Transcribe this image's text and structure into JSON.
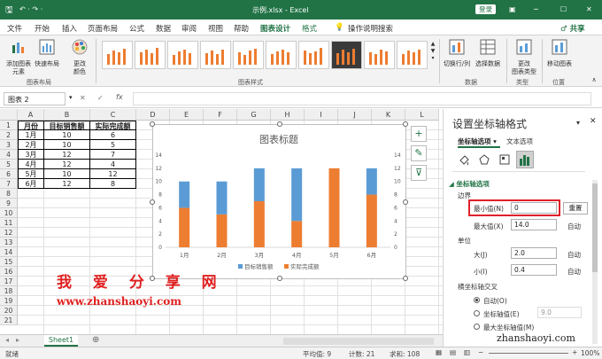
{
  "titlebar": {
    "qat_autosave": "↶ · ↷ ·",
    "filename": "示例.xlsx - Excel",
    "login": "登录",
    "window_controls": [
      "─",
      "☐",
      "✕"
    ]
  },
  "tabs": [
    "文件",
    "开始",
    "插入",
    "页面布局",
    "公式",
    "数据",
    "审阅",
    "视图",
    "帮助",
    "图表设计",
    "格式"
  ],
  "active_tab": "图表设计",
  "tell_me": "操作说明搜索",
  "share": "共享",
  "ribbon": {
    "add_element": "添加图表\n元素",
    "quick_layout": "快速布局",
    "change_colors": "更改\n颜色",
    "group_layout": "图表布局",
    "group_styles": "图表样式",
    "switch_rowcol": "切换行/列",
    "select_data": "选择数据",
    "group_data": "数据",
    "change_type": "更改\n图表类型",
    "group_type": "类型",
    "move_chart": "移动图表",
    "group_location": "位置"
  },
  "formula_bar": {
    "name_box": "图表 2",
    "cancel": "✕",
    "enter": "✓",
    "fx": "fx"
  },
  "columns": [
    "A",
    "B",
    "C",
    "D",
    "E",
    "F",
    "G",
    "H",
    "I",
    "J",
    "K",
    "L"
  ],
  "rows": [
    "1",
    "2",
    "3",
    "4",
    "5",
    "6",
    "7",
    "8",
    "9",
    "10",
    "11",
    "12",
    "13",
    "14",
    "15",
    "16",
    "17",
    "18",
    "19",
    "20",
    "21"
  ],
  "table": {
    "headers": [
      "月份",
      "目标销售额",
      "实际完成额"
    ],
    "rows": [
      [
        "1月",
        "10",
        "6"
      ],
      [
        "2月",
        "10",
        "5"
      ],
      [
        "3月",
        "12",
        "7"
      ],
      [
        "4月",
        "12",
        "4"
      ],
      [
        "5月",
        "10",
        "12"
      ],
      [
        "6月",
        "12",
        "8"
      ]
    ]
  },
  "chart_data": {
    "type": "bar",
    "stacked": true,
    "title": "图表标题",
    "categories": [
      "1月",
      "2月",
      "3月",
      "4月",
      "5月",
      "6月"
    ],
    "series": [
      {
        "name": "实际完成额",
        "values": [
          6,
          5,
          7,
          4,
          12,
          8
        ],
        "color": "#ed7d31"
      },
      {
        "name": "目标销售额",
        "values": [
          4,
          5,
          5,
          8,
          0,
          4
        ],
        "color": "#5b9bd5"
      }
    ],
    "ylim": [
      0,
      14
    ],
    "yticks": [
      "0",
      "2",
      "4",
      "6",
      "8",
      "10",
      "12",
      "14"
    ],
    "secondary_yticks": [
      "0",
      "2",
      "4",
      "6",
      "8",
      "10",
      "12",
      "14"
    ],
    "legend_position": "bottom",
    "legend": [
      {
        "name": "目标销售额",
        "color": "#5b9bd5"
      },
      {
        "name": "实际完成额",
        "color": "#ed7d31"
      }
    ]
  },
  "chart_tools": [
    "+",
    "✎",
    "⊽"
  ],
  "sheet_tab": "Sheet1",
  "status": {
    "ready": "就绪",
    "average": "平均值: 9",
    "count": "计数: 21",
    "sum": "求和: 108",
    "zoom": "100%"
  },
  "pane": {
    "title": "设置坐标轴格式",
    "tab_axis": "坐标轴选项",
    "tab_text": "文本选项",
    "section": "坐标轴选项",
    "bounds": "边界",
    "min_label": "最小值(N)",
    "min_value": "0",
    "reset": "重置",
    "max_label": "最大值(X)",
    "max_value": "14.0",
    "auto": "自动",
    "units": "单位",
    "major_label": "大(J)",
    "major_value": "2.0",
    "minor_label": "小(I)",
    "minor_value": "0.4",
    "cross_label": "横坐标轴交叉",
    "cross_auto": "自动(O)",
    "cross_value_label": "坐标轴值(E)",
    "cross_value": "9.0",
    "cross_max": "最大坐标轴值(M)"
  },
  "watermark": {
    "text": "我 爱 分 享 网",
    "url": "www.zhanshaoyi.com",
    "corner": "zhanshaoyi.com"
  }
}
